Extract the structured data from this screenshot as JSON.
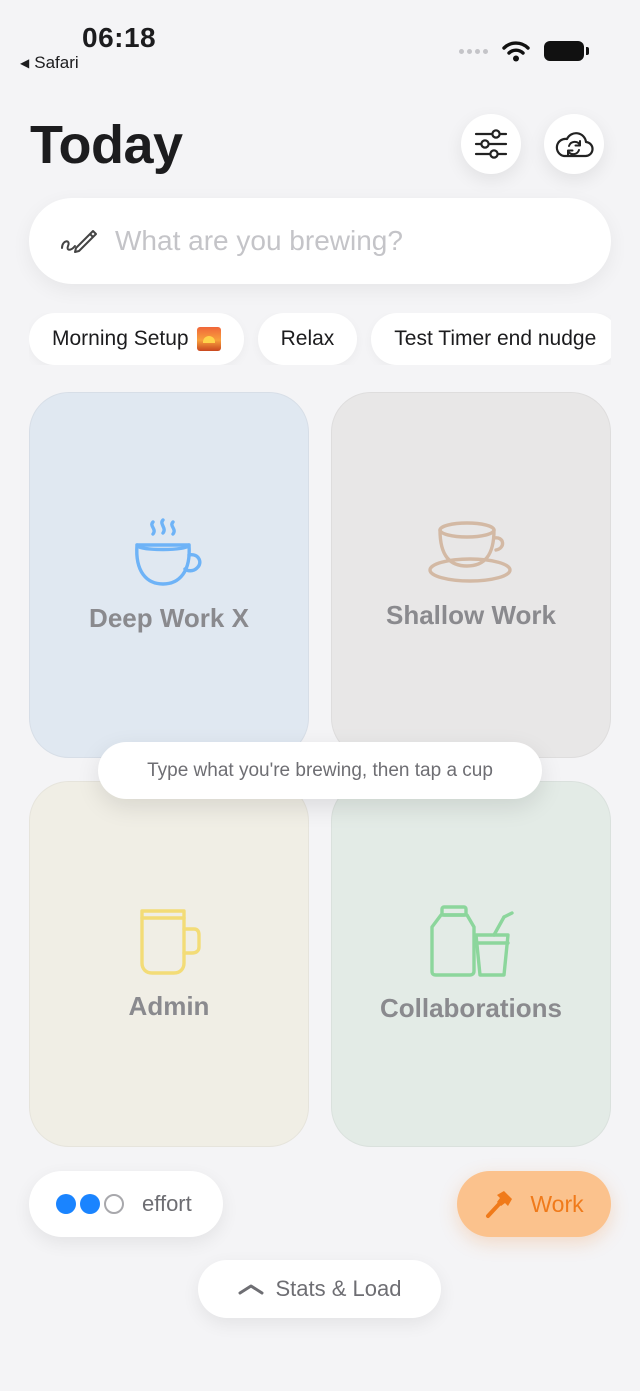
{
  "status_bar": {
    "time": "06:18",
    "back_label": "Safari"
  },
  "header": {
    "title": "Today"
  },
  "search": {
    "placeholder": "What are you brewing?",
    "value": ""
  },
  "chips": [
    {
      "label": "Morning Setup",
      "icon": "sunrise-emoji"
    },
    {
      "label": "Relax"
    },
    {
      "label": "Test Timer end nudge"
    }
  ],
  "cards": {
    "deep": {
      "label": "Deep Work X",
      "icon": "steaming-cup-icon",
      "color": "#6eb3f7"
    },
    "shallow": {
      "label": "Shallow Work",
      "icon": "teacup-saucer-icon",
      "color": "#d3b9a4"
    },
    "admin": {
      "label": "Admin",
      "icon": "mug-icon",
      "color": "#f3dc77"
    },
    "collab": {
      "label": "Collaborations",
      "icon": "jar-and-glass-icon",
      "color": "#8cd69c"
    }
  },
  "tooltip": {
    "text": "Type what you're brewing, then tap a cup"
  },
  "effort": {
    "label": "effort",
    "level": 2,
    "max": 3,
    "accent": "#1a84ff"
  },
  "mode_button": {
    "label": "Work",
    "icon": "hammer-icon",
    "color": "#f07a1a"
  },
  "stats_button": {
    "label": "Stats & Load",
    "icon": "chevron-up-icon"
  }
}
